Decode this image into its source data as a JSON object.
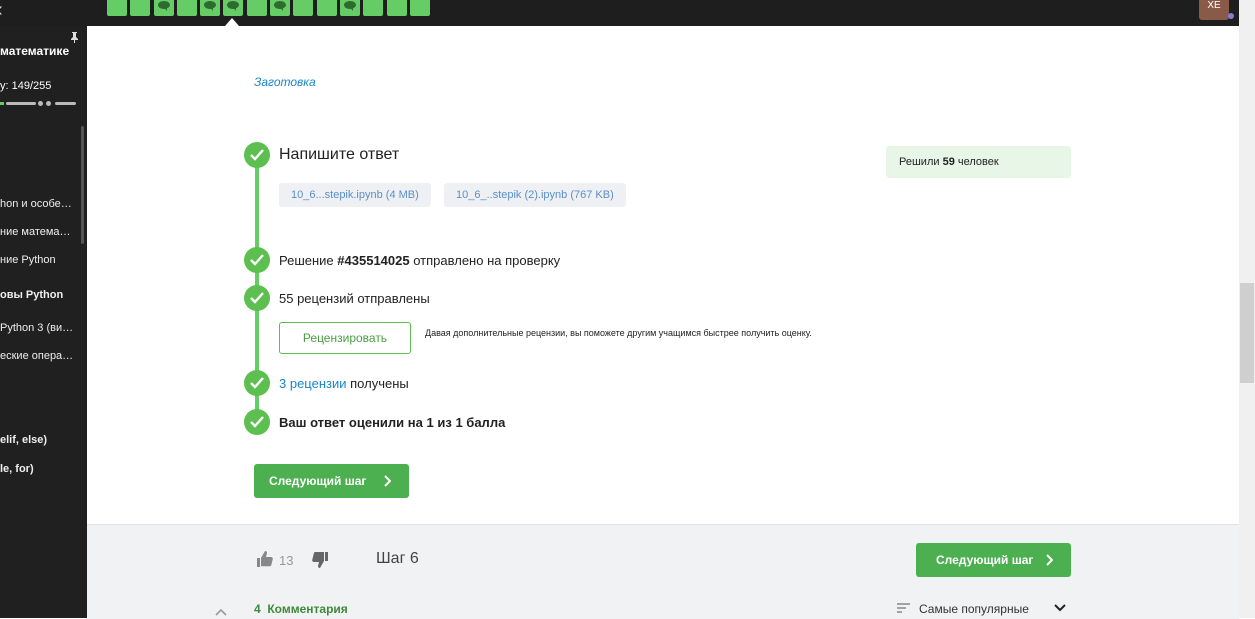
{
  "topbar": {
    "steps": [
      {
        "done": true,
        "comment": false
      },
      {
        "done": true,
        "comment": false
      },
      {
        "done": true,
        "comment": true
      },
      {
        "done": true,
        "comment": false
      },
      {
        "done": true,
        "comment": true
      },
      {
        "done": true,
        "comment": true,
        "current": true
      },
      {
        "done": true,
        "comment": false
      },
      {
        "done": true,
        "comment": true
      },
      {
        "done": true,
        "comment": false
      },
      {
        "done": true,
        "comment": false
      },
      {
        "done": true,
        "comment": true
      },
      {
        "done": true,
        "comment": false
      },
      {
        "done": true,
        "comment": false
      },
      {
        "done": true,
        "comment": false
      }
    ],
    "avatar_initials": "ХЕ"
  },
  "sidebar": {
    "course_title": "математике",
    "progress_text": "у:  149/255",
    "progress_fraction": 0.584,
    "items": [
      {
        "label": "hon и особе…",
        "bold": false
      },
      {
        "label": "ние матема…",
        "bold": false
      },
      {
        "label": "ние Python",
        "bold": false
      },
      {
        "label": "овы Python",
        "bold": true
      },
      {
        "label": "Python 3 (ви…",
        "bold": false
      },
      {
        "label": "еские опера…",
        "bold": false
      },
      {
        "label": "elif, else)",
        "bold": true
      },
      {
        "label": "le, for)",
        "bold": true
      }
    ]
  },
  "main": {
    "blank_link": "Заготовка",
    "answer_title": "Напишите ответ",
    "files": [
      "10_6...stepik.ipynb (4 MB)",
      "10_6_..stepik (2).ipynb (767 KB)"
    ],
    "solved": {
      "prefix": "Решили",
      "count": "59",
      "suffix": "человек"
    },
    "status": {
      "solution_prefix": "Решение",
      "solution_id": "#435514025",
      "solution_suffix": "отправлено на проверку",
      "reviews_sent": "55 рецензий отправлены",
      "reviews_received_link": "3 рецензии",
      "reviews_received_suffix": "получены",
      "score_prefix": "Ваш ответ оценили на",
      "score_value": "1",
      "score_mid": "из",
      "score_max": "1",
      "score_suffix": "балла"
    },
    "review_button": "Рецензировать",
    "review_hint": "Давая дополнительные рецензии, вы поможете другим учащимся быстрее получить оценку.",
    "next_step_button": "Следующий шаг"
  },
  "footer": {
    "likes": "13",
    "step_label": "Шаг 6",
    "next_step_button": "Следующий шаг",
    "comments_count": "4",
    "comments_label": "Комментария",
    "sort_label": "Самые популярные"
  },
  "colors": {
    "accent_green": "#4caf50",
    "check_green": "#5cbf50",
    "link_blue": "#1a86c8",
    "topbar_bg": "#1e1e1e"
  }
}
